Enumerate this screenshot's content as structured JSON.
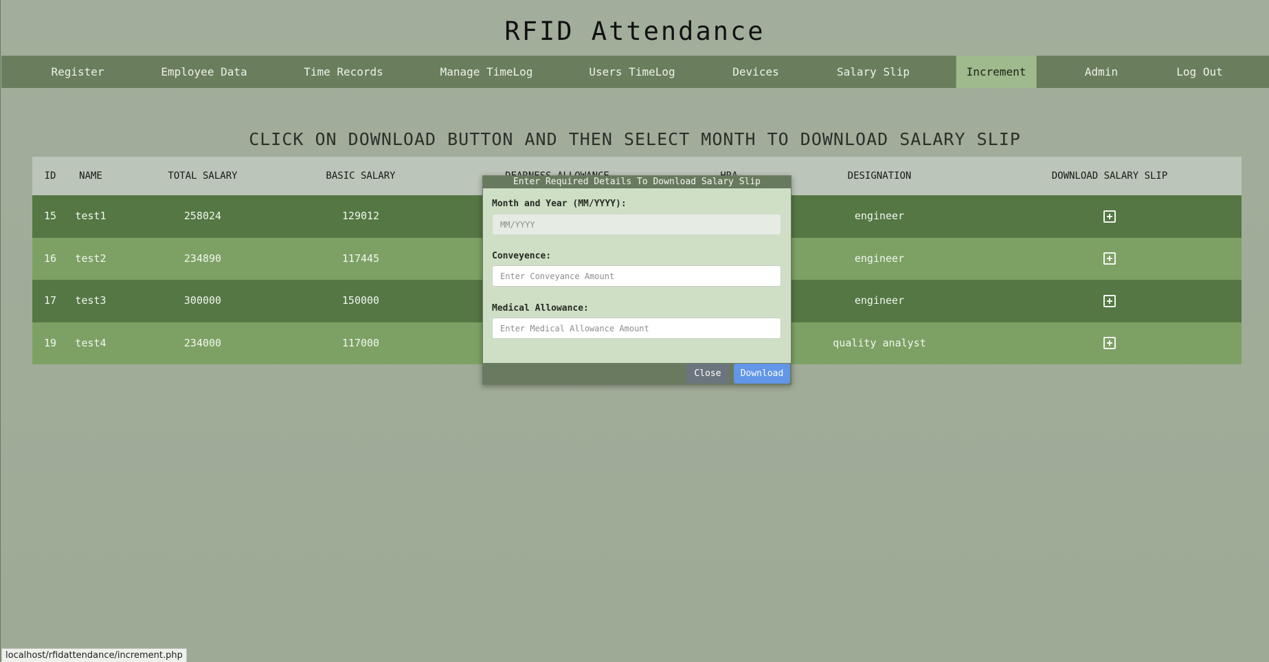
{
  "app": {
    "title": "RFID Attendance"
  },
  "nav": [
    {
      "label": "Register",
      "active": false
    },
    {
      "label": "Employee Data",
      "active": false
    },
    {
      "label": "Time Records",
      "active": false
    },
    {
      "label": "Manage TimeLog",
      "active": false
    },
    {
      "label": "Users TimeLog",
      "active": false
    },
    {
      "label": "Devices",
      "active": false
    },
    {
      "label": "Salary Slip",
      "active": false
    },
    {
      "label": "Increment",
      "active": true
    },
    {
      "label": "Admin",
      "active": false
    },
    {
      "label": "Log Out",
      "active": false
    }
  ],
  "page": {
    "heading": "CLICK ON DOWNLOAD BUTTON AND THEN SELECT MONTH TO DOWNLOAD SALARY SLIP"
  },
  "table": {
    "headers": [
      "ID",
      "NAME",
      "TOTAL SALARY",
      "BASIC SALARY",
      "DEARNESS ALLOWANCE",
      "HRA",
      "DESIGNATION",
      "DOWNLOAD SALARY SLIP"
    ],
    "rows": [
      {
        "id": "15",
        "name": "test1",
        "total": "258024",
        "basic": "129012",
        "designation": "engineer",
        "action_icon": "plus-square-icon"
      },
      {
        "id": "16",
        "name": "test2",
        "total": "234890",
        "basic": "117445",
        "designation": "engineer",
        "action_icon": "plus-square-icon"
      },
      {
        "id": "17",
        "name": "test3",
        "total": "300000",
        "basic": "150000",
        "designation": "engineer",
        "action_icon": "plus-square-icon"
      },
      {
        "id": "19",
        "name": "test4",
        "total": "234000",
        "basic": "117000",
        "designation": "quality analyst",
        "action_icon": "plus-square-icon"
      }
    ]
  },
  "modal": {
    "title": "Enter Required Details To Download Salary Slip",
    "month_label": "Month and Year (MM/YYYY):",
    "month_placeholder": "MM/YYYY",
    "conveyance_label": "Conveyence:",
    "conveyance_placeholder": "Enter Conveyance Amount",
    "medical_label": "Medical Allowance:",
    "medical_placeholder": "Enter Medical Allowance Amount",
    "close_label": "Close",
    "download_label": "Download"
  },
  "status_bar": {
    "url": "localhost/rfidattendance/increment.php"
  },
  "colors": {
    "background": "#a2ad9b",
    "navbar": "#6a7e5d",
    "nav_active": "#9fba8d",
    "row_dark": "#547744",
    "row_light": "#7da165",
    "modal_body": "#cfdfc6",
    "download_button": "#6196e8",
    "close_button": "#6c757d"
  }
}
